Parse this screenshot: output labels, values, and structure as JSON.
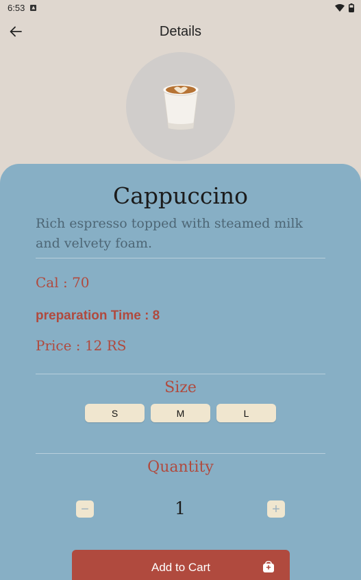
{
  "status_bar": {
    "time": "6:53",
    "icons": [
      "notification-icon",
      "wifi-icon",
      "battery-icon"
    ]
  },
  "app_bar": {
    "title": "Details",
    "back_icon": "arrow-back-icon"
  },
  "product": {
    "image_icon": "cappuccino-cup-icon",
    "name": "Cappuccino",
    "description": "Rich espresso topped with steamed milk and velvety foam.",
    "cal": "Cal : 70",
    "prep_time": "preparation Time : 8",
    "price": "Price : 12 RS"
  },
  "size": {
    "title": "Size",
    "options": [
      "S",
      "M",
      "L"
    ]
  },
  "quantity": {
    "title": "Quantity",
    "value": "1",
    "decrement_label": "−",
    "increment_label": "+"
  },
  "cart": {
    "button_label": "Add to Cart",
    "icon": "cart-add-icon"
  },
  "colors": {
    "background": "#dfd7cf",
    "sheet": "#87afc5",
    "accent": "#b04a3e",
    "chip": "#f0e6cf"
  }
}
